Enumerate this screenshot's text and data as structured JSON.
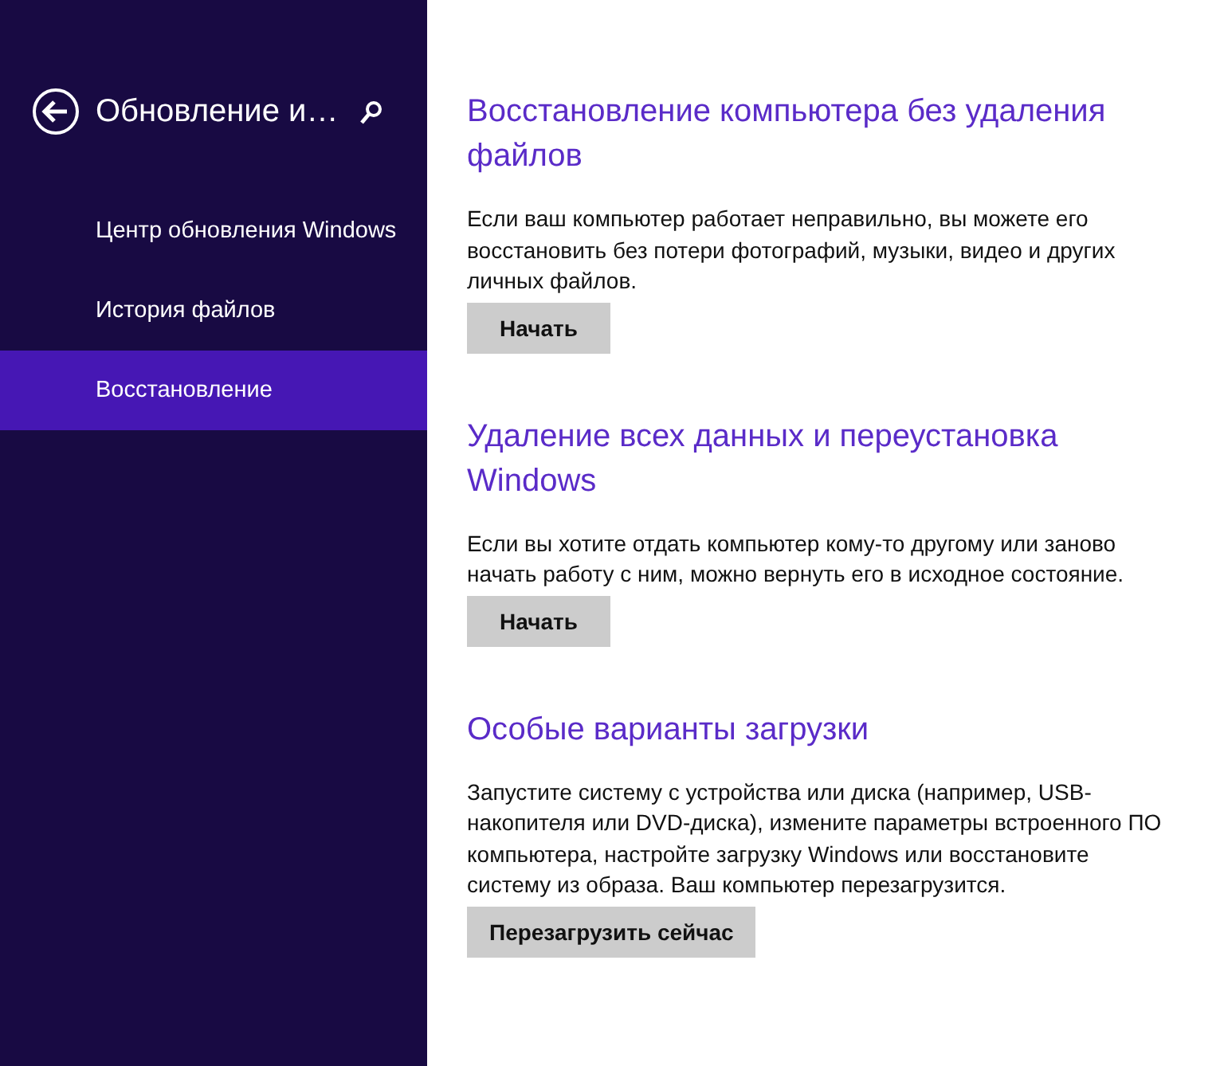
{
  "sidebar": {
    "title": "Обновление и…",
    "items": [
      {
        "label": "Центр обновления Windows",
        "selected": false
      },
      {
        "label": "История файлов",
        "selected": false
      },
      {
        "label": "Восстановление",
        "selected": true
      }
    ]
  },
  "sections": [
    {
      "heading": "Восстановление компьютера без удаления файлов",
      "description": "Если ваш компьютер работает неправильно, вы можете его восстановить без потери фотографий, музыки, видео и других личных файлов.",
      "button": "Начать"
    },
    {
      "heading": "Удаление всех данных и переустановка Windows",
      "description": "Если вы хотите отдать компьютер кому-то другому или заново начать работу с ним, можно вернуть его в исходное состояние.",
      "button": "Начать"
    },
    {
      "heading": "Особые варианты загрузки",
      "description": "Запустите систему с устройства или диска (например, USB-накопителя или DVD-диска), измените параметры встроенного ПО компьютера, настройте загрузку Windows или восстановите систему из образа. Ваш компьютер перезагрузится.",
      "button": "Перезагрузить сейчас"
    }
  ]
}
